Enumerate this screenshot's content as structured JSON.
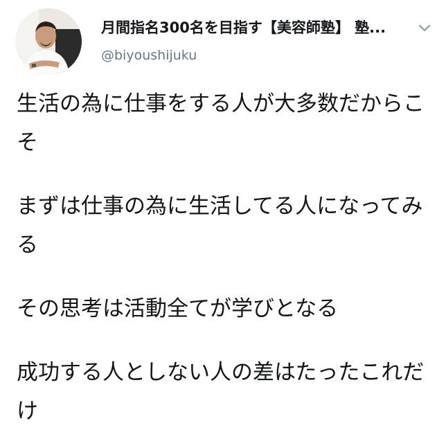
{
  "tweet": {
    "display_name": "月間指名300名を目指す【美容師塾】 塾...",
    "handle": "@biyoushijuku",
    "paragraphs": [
      "生活の為に仕事をする人が大多数だからこそ",
      "まずは仕事の為に生活してる人になってみる",
      "その思考は活動全てが学びとなる",
      "成功する人としない人の差はたったこれだけ"
    ]
  },
  "icons": {
    "more": "chevron-down-icon",
    "avatar": "avatar"
  },
  "colors": {
    "name": "#14171a",
    "handle": "#657786",
    "chevron": "#8899a6",
    "background": "#ffffff"
  }
}
